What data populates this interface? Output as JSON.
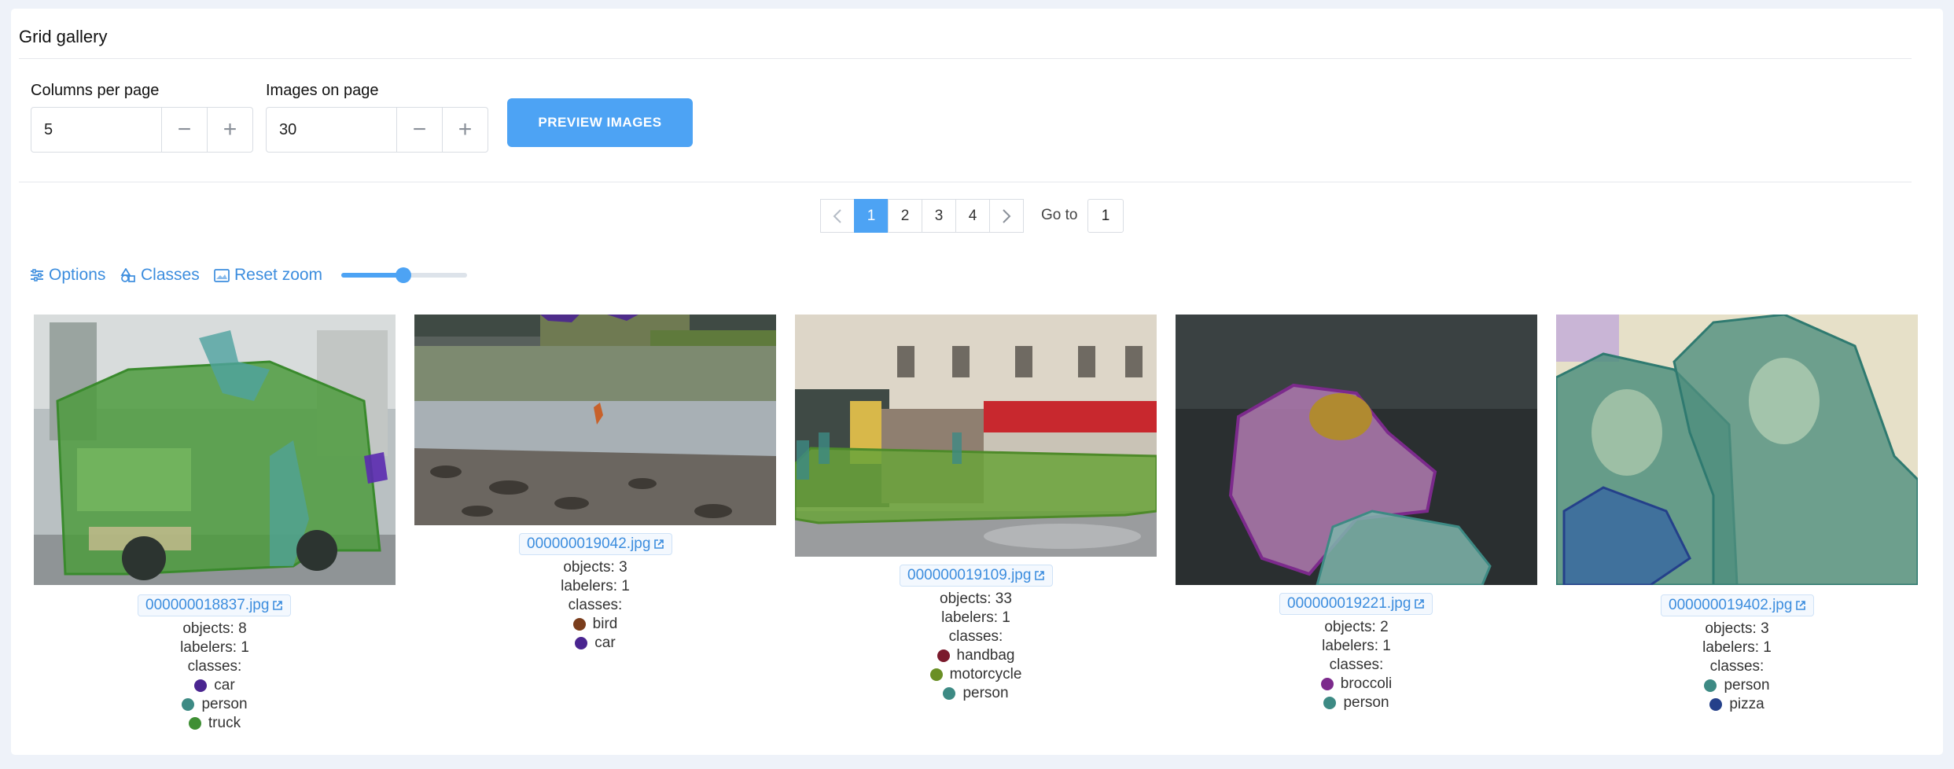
{
  "header": {
    "title": "Grid gallery"
  },
  "controls": {
    "columns": {
      "label": "Columns per page",
      "value": "5"
    },
    "images": {
      "label": "Images on page",
      "value": "30"
    },
    "preview_label": "PREVIEW IMAGES"
  },
  "pagination": {
    "pages": [
      "1",
      "2",
      "3",
      "4"
    ],
    "current": "1",
    "goto_label": "Go to",
    "goto_value": "1"
  },
  "toolbar": {
    "options_label": "Options",
    "classes_label": "Classes",
    "reset_zoom_label": "Reset zoom",
    "zoom_level": 0.5
  },
  "gallery": [
    {
      "filename": "000000018837.jpg",
      "objects_line": "objects: 8",
      "labelers_line": "labelers: 1",
      "classes_label": "classes:",
      "classes": [
        {
          "name": "car",
          "color": "#4a2590"
        },
        {
          "name": "person",
          "color": "#3d8a84"
        },
        {
          "name": "truck",
          "color": "#3f8f34"
        }
      ]
    },
    {
      "filename": "000000019042.jpg",
      "objects_line": "objects: 3",
      "labelers_line": "labelers: 1",
      "classes_label": "classes:",
      "classes": [
        {
          "name": "bird",
          "color": "#7a3d1c"
        },
        {
          "name": "car",
          "color": "#4a2590"
        }
      ]
    },
    {
      "filename": "000000019109.jpg",
      "objects_line": "objects: 33",
      "labelers_line": "labelers: 1",
      "classes_label": "classes:",
      "classes": [
        {
          "name": "handbag",
          "color": "#7a1a2c"
        },
        {
          "name": "motorcycle",
          "color": "#6a8f25"
        },
        {
          "name": "person",
          "color": "#3d8a84"
        }
      ]
    },
    {
      "filename": "000000019221.jpg",
      "objects_line": "objects: 2",
      "labelers_line": "labelers: 1",
      "classes_label": "classes:",
      "classes": [
        {
          "name": "broccoli",
          "color": "#7c2a8c"
        },
        {
          "name": "person",
          "color": "#3d8a84"
        }
      ]
    },
    {
      "filename": "000000019402.jpg",
      "objects_line": "objects: 3",
      "labelers_line": "labelers: 1",
      "classes_label": "classes:",
      "classes": [
        {
          "name": "person",
          "color": "#3d8a84"
        },
        {
          "name": "pizza",
          "color": "#24408a"
        }
      ]
    }
  ],
  "colors": {
    "accent": "#4da3f4",
    "link": "#3c8dde"
  }
}
